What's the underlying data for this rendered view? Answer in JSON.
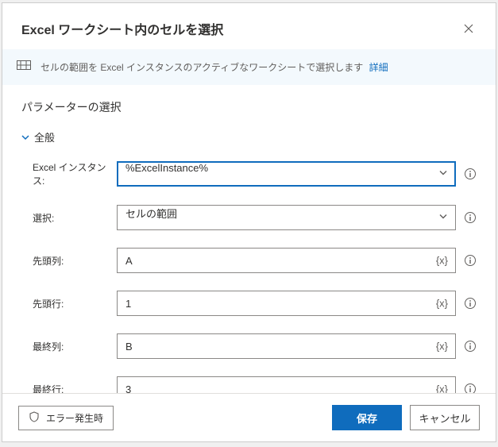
{
  "dialog": {
    "title": "Excel ワークシート内のセルを選択",
    "info": {
      "text": "セルの範囲を Excel インスタンスのアクティブなワークシートで選択します",
      "link": "詳細"
    }
  },
  "section": {
    "title": "パラメーターの選択",
    "group": "全般"
  },
  "fields": {
    "instance": {
      "label": "Excel インスタンス:",
      "value": "%ExcelInstance%"
    },
    "select": {
      "label": "選択:",
      "value": "セルの範囲"
    },
    "startCol": {
      "label": "先頭列:",
      "value": "A",
      "token": "{x}"
    },
    "startRow": {
      "label": "先頭行:",
      "value": "1",
      "token": "{x}"
    },
    "endCol": {
      "label": "最終列:",
      "value": "B",
      "token": "{x}"
    },
    "endRow": {
      "label": "最終行:",
      "value": "3",
      "token": "{x}"
    }
  },
  "footer": {
    "error": "エラー発生時",
    "save": "保存",
    "cancel": "キャンセル"
  }
}
